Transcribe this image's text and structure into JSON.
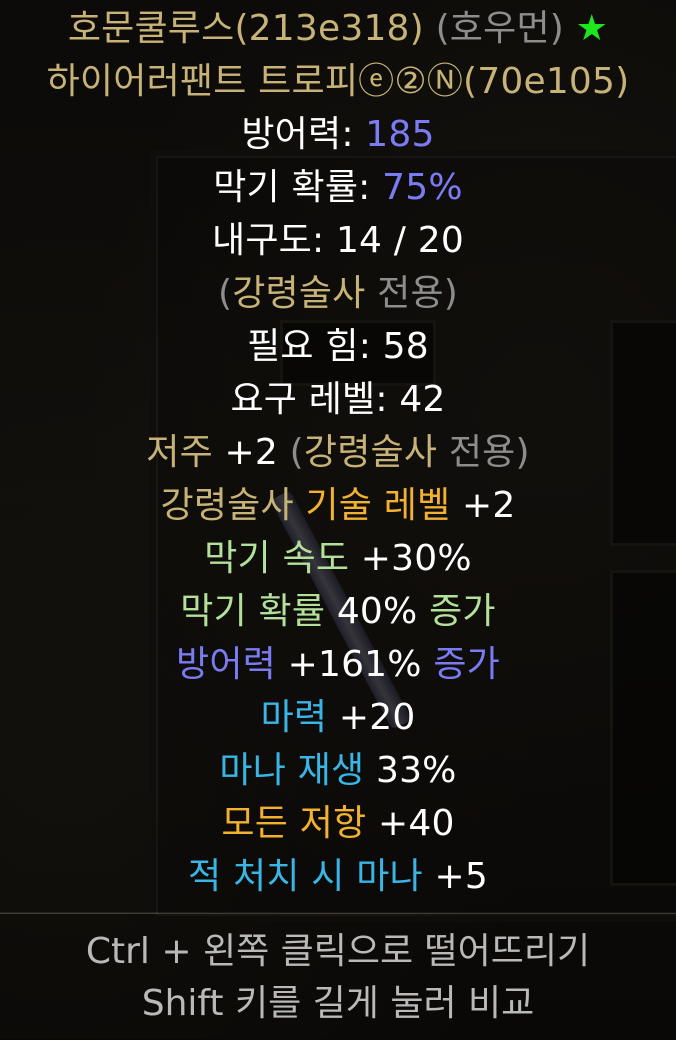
{
  "item": {
    "name": "호문쿨루스",
    "code": "(213e318)",
    "tag": "(호우먼)",
    "star": "★",
    "base_name": "하이어러팬트 트로피",
    "badges": "ⓔ②Ⓝ",
    "base_code": "(70e105)"
  },
  "stats": {
    "defense_label": "방어력: ",
    "defense_value": "185",
    "block_label": "막기 확률: ",
    "block_value": "75%",
    "durability": "내구도: 14 / 20",
    "class_open": "(",
    "class_name": "강령술사",
    "class_exclusive": " 전용)",
    "req_str": "필요 힘: 58",
    "req_level": "요구 레벨: 42"
  },
  "mods": {
    "curse_label": "저주",
    "curse_value": " +2 ",
    "curse_class_open": "(",
    "curse_class": "강령술사",
    "curse_class_exclusive": " 전용)",
    "skill_class": "강령술사",
    "skill_label": " 기술 레벨",
    "skill_value": " +2",
    "block_speed_label": "막기 속도",
    "block_speed_value": " +30%",
    "block_chance_label": "막기 확률",
    "block_chance_value": " 40%",
    "block_chance_suffix": " 증가",
    "defense_label": "방어력",
    "defense_value": " +161%",
    "defense_suffix": " 증가",
    "energy_label": "마력",
    "energy_value": " +20",
    "mana_regen_label": "마나 재생",
    "mana_regen_value": " 33%",
    "all_res_label": "모든 저항",
    "all_res_value": " +40",
    "mana_kill_label": "적 처치 시 마나",
    "mana_kill_value": " +5"
  },
  "footer": {
    "drop_hint": "Ctrl + 왼쪽 클릭으로 떨어뜨리기",
    "compare_hint": "Shift 키를 길게 눌러 비교"
  },
  "colors": {
    "gold": "#c7b377",
    "blue": "#7b7bf4",
    "orange": "#f2b12f",
    "green": "#b3e09a",
    "cyan": "#39b6e6",
    "star": "#1ee51e"
  }
}
